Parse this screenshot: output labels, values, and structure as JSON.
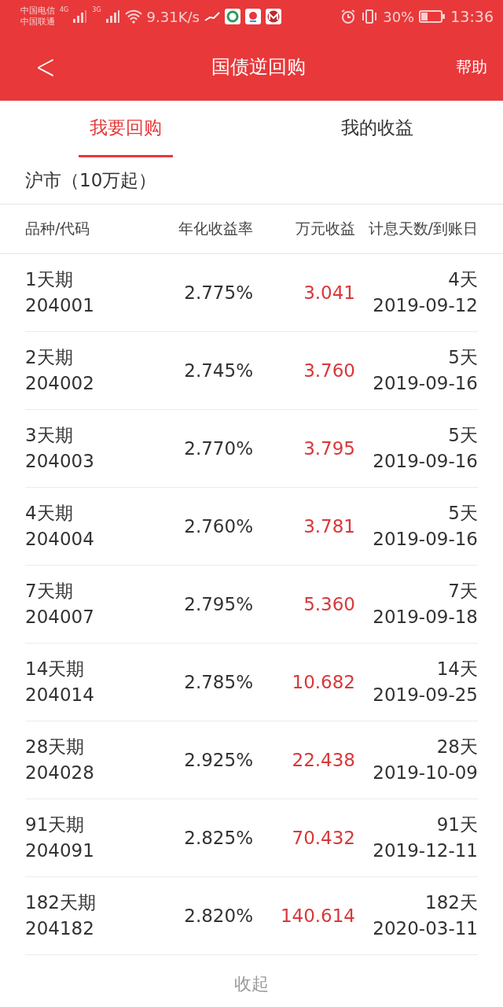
{
  "status_bar": {
    "carriers": [
      "中国电信",
      "中国联通"
    ],
    "net1": "4G",
    "net2": "3G",
    "speed": "9.31K/s",
    "battery": "30%",
    "time": "13:36"
  },
  "header": {
    "back": "<",
    "title": "国债逆回购",
    "help": "帮助"
  },
  "tabs": [
    {
      "label": "我要回购",
      "selected": true
    },
    {
      "label": "我的收益",
      "selected": false
    }
  ],
  "market": "沪市（10万起）",
  "table": {
    "columns": [
      "品种/代码",
      "年化收益率",
      "万元收益",
      "计息天数/到账日"
    ],
    "rows": [
      {
        "name": "1天期",
        "code": "204001",
        "rate": "2.775%",
        "income": "3.041",
        "days": "4天",
        "date": "2019-09-12"
      },
      {
        "name": "2天期",
        "code": "204002",
        "rate": "2.745%",
        "income": "3.760",
        "days": "5天",
        "date": "2019-09-16"
      },
      {
        "name": "3天期",
        "code": "204003",
        "rate": "2.770%",
        "income": "3.795",
        "days": "5天",
        "date": "2019-09-16"
      },
      {
        "name": "4天期",
        "code": "204004",
        "rate": "2.760%",
        "income": "3.781",
        "days": "5天",
        "date": "2019-09-16"
      },
      {
        "name": "7天期",
        "code": "204007",
        "rate": "2.795%",
        "income": "5.360",
        "days": "7天",
        "date": "2019-09-18"
      },
      {
        "name": "14天期",
        "code": "204014",
        "rate": "2.785%",
        "income": "10.682",
        "days": "14天",
        "date": "2019-09-25"
      },
      {
        "name": "28天期",
        "code": "204028",
        "rate": "2.925%",
        "income": "22.438",
        "days": "28天",
        "date": "2019-10-09"
      },
      {
        "name": "91天期",
        "code": "204091",
        "rate": "2.825%",
        "income": "70.432",
        "days": "91天",
        "date": "2019-12-11"
      },
      {
        "name": "182天期",
        "code": "204182",
        "rate": "2.820%",
        "income": "140.614",
        "days": "182天",
        "date": "2020-03-11"
      }
    ]
  },
  "collapse": "收起"
}
